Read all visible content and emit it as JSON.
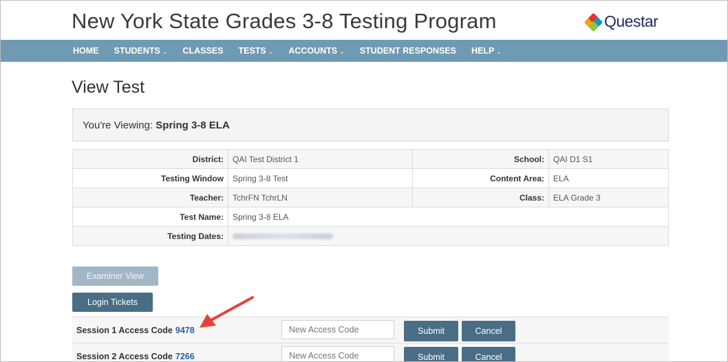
{
  "header": {
    "title": "New York State Grades 3-8 Testing Program",
    "logo_text": "Questar"
  },
  "nav": {
    "items": [
      {
        "label": "HOME",
        "caret": ""
      },
      {
        "label": "STUDENTS",
        "caret": "⌄"
      },
      {
        "label": "CLASSES",
        "caret": ""
      },
      {
        "label": "TESTS",
        "caret": "⌄"
      },
      {
        "label": "ACCOUNTS",
        "caret": "⌄"
      },
      {
        "label": "STUDENT RESPONSES",
        "caret": ""
      },
      {
        "label": "HELP",
        "caret": "⌄"
      }
    ]
  },
  "page": {
    "title": "View Test",
    "viewing_prefix": "You're Viewing:",
    "viewing_name": "Spring 3-8 ELA"
  },
  "info": {
    "district_label": "District:",
    "district_value": "QAI Test District 1",
    "school_label": "School:",
    "school_value": "QAI D1 S1",
    "window_label": "Testing Window",
    "window_value": "Spring 3-8 Test",
    "content_label": "Content Area:",
    "content_value": "ELA",
    "teacher_label": "Teacher:",
    "teacher_value": "TchrFN TchrLN",
    "class_label": "Class:",
    "class_value": "ELA Grade 3",
    "testname_label": "Test Name:",
    "testname_value": "Spring 3-8 ELA",
    "dates_label": "Testing Dates:"
  },
  "buttons": {
    "examiner_view": "Examiner View",
    "login_tickets": "Login Tickets"
  },
  "sessions": [
    {
      "label": "Session 1 Access Code",
      "code": "9478",
      "placeholder": "New Access Code",
      "submit": "Submit",
      "cancel": "Cancel"
    },
    {
      "label": "Session 2 Access Code",
      "code": "7266",
      "placeholder": "New Access Code",
      "submit": "Submit",
      "cancel": "Cancel"
    }
  ],
  "colors": {
    "nav_bg": "#6f9ab4",
    "button_dark": "#4a6d86",
    "button_light": "#a1b6c6",
    "link": "#2d5da0",
    "annotation_arrow": "#e8413a"
  }
}
